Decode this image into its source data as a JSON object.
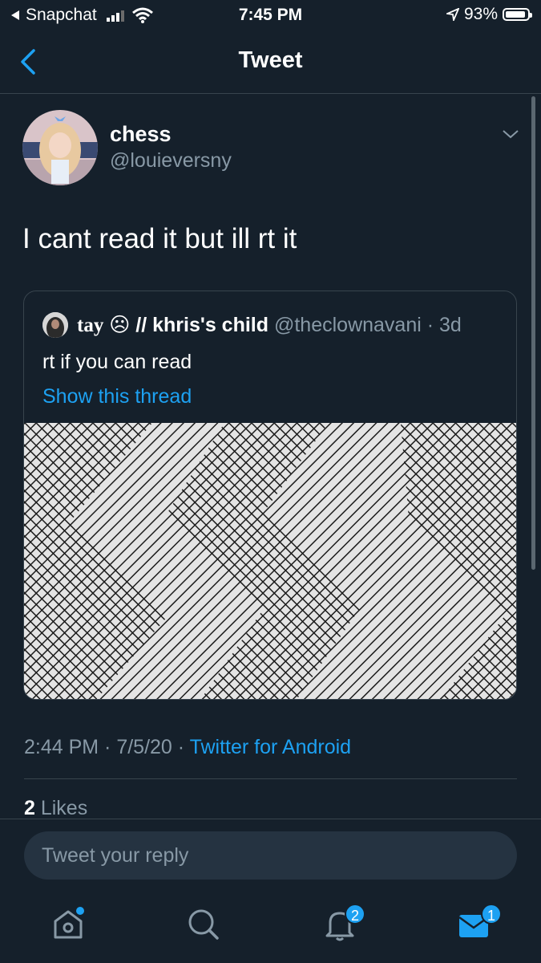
{
  "status_bar": {
    "back_app": "Snapchat",
    "time": "7:45 PM",
    "battery": "93%",
    "battery_level": 0.93
  },
  "nav": {
    "title": "Tweet"
  },
  "tweet": {
    "name": "chess",
    "handle": "@louieversny",
    "text": "I cant read it but ill rt it",
    "time": "2:44 PM",
    "sep1": " · ",
    "date": "7/5/20",
    "sep2": " · ",
    "source": "Twitter for Android"
  },
  "quoted": {
    "name_part1": "tay",
    "name_emoji": " ☹ ",
    "name_part2": "// khris's child",
    "handle": " @theclownavani",
    "age": " · 3d",
    "text": "rt if you can read",
    "thread_link": "Show this thread"
  },
  "stats": {
    "likes_count": "2",
    "likes_label": " Likes"
  },
  "reply": {
    "placeholder": "Tweet your reply"
  },
  "tabs": {
    "notifications_badge": "2",
    "messages_badge": "1"
  },
  "colors": {
    "background": "#15202b",
    "accent": "#1da1f2",
    "secondary_text": "#8899a6",
    "divider": "#38444d"
  },
  "icons": [
    "back-arrow-icon",
    "wifi-icon",
    "signal-icon",
    "location-icon",
    "battery-icon",
    "chevron-down-icon",
    "home-icon",
    "search-icon",
    "bell-icon",
    "mail-icon"
  ]
}
